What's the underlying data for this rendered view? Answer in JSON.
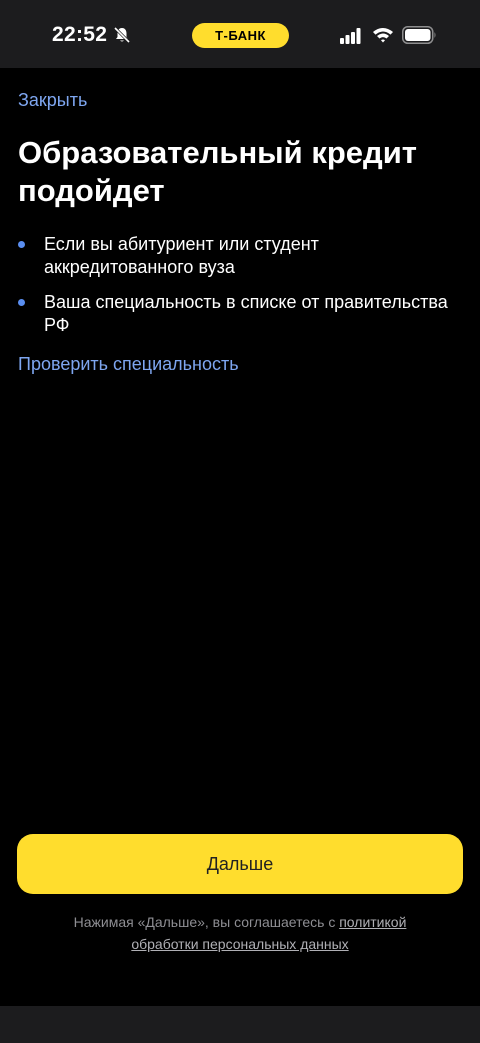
{
  "status_bar": {
    "time": "22:52",
    "bank_label": "Т-БАНК",
    "bank_color": "#ffdd2d"
  },
  "header": {
    "close_label": "Закрыть"
  },
  "main": {
    "title": "Образовательный кредит подойдет",
    "bullets": [
      {
        "text": "Если вы абитуриент или студент аккредитованного вуза"
      },
      {
        "text": "Ваша специальность в списке от правительства РФ"
      }
    ],
    "check_link": "Проверить специальность"
  },
  "footer": {
    "next_label": "Дальше",
    "consent_prefix": "Нажимая «Дальше», вы соглашаетесь с ",
    "consent_link": "политикой обработки персональных данных"
  },
  "colors": {
    "accent_yellow": "#ffdd2d",
    "link_blue": "#7ea6f0",
    "bullet_blue": "#5a8ef0",
    "background": "#000000"
  }
}
